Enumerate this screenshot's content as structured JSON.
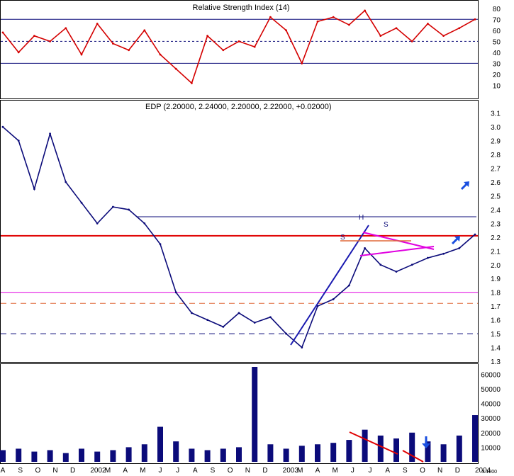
{
  "chart_data": [
    {
      "panel": "rsi",
      "type": "line",
      "title": "Relative Strength Index (14)",
      "y_ticks": [
        "80",
        "70",
        "60",
        "50",
        "40",
        "30",
        "20",
        "10"
      ],
      "ylim": [
        0,
        85
      ],
      "reference_lines": [
        {
          "value": 70,
          "style": "solid",
          "color": "#0b0b7a"
        },
        {
          "value": 50,
          "style": "dotted",
          "color": "#0b0b7a"
        },
        {
          "value": 30,
          "style": "solid",
          "color": "#0b0b7a"
        }
      ],
      "series": [
        {
          "color": "#d40000",
          "points": [
            [
              "2001-08",
              58
            ],
            [
              "2001-09",
              40
            ],
            [
              "2001-10",
              55
            ],
            [
              "2001-11",
              50
            ],
            [
              "2001-12",
              62
            ],
            [
              "2002-01",
              38
            ],
            [
              "2002-02",
              66
            ],
            [
              "2002-03",
              48
            ],
            [
              "2002-04",
              42
            ],
            [
              "2002-05",
              60
            ],
            [
              "2002-06",
              38
            ],
            [
              "2002-07",
              25
            ],
            [
              "2002-08",
              12
            ],
            [
              "2002-09",
              55
            ],
            [
              "2002-10",
              42
            ],
            [
              "2002-11",
              50
            ],
            [
              "2002-12",
              45
            ],
            [
              "2003-01",
              72
            ],
            [
              "2003-02",
              60
            ],
            [
              "2003-03",
              30
            ],
            [
              "2003-04",
              68
            ],
            [
              "2003-05",
              72
            ],
            [
              "2003-06",
              65
            ],
            [
              "2003-07",
              78
            ],
            [
              "2003-08",
              55
            ],
            [
              "2003-09",
              62
            ],
            [
              "2003-10",
              50
            ],
            [
              "2003-11",
              66
            ],
            [
              "2003-12",
              55
            ],
            [
              "2004-01",
              62
            ],
            [
              "2004-02",
              70
            ]
          ]
        }
      ],
      "grid": false
    },
    {
      "panel": "price",
      "type": "line",
      "title": "EDP (2.20000, 2.24000, 2.20000, 2.22000, +0.02000)",
      "y_ticks": [
        "3.1",
        "3.0",
        "2.9",
        "2.8",
        "2.7",
        "2.6",
        "2.5",
        "2.4",
        "2.3",
        "2.2",
        "2.1",
        "2.0",
        "1.9",
        "1.8",
        "1.7",
        "1.6",
        "1.5",
        "1.4",
        "1.3"
      ],
      "ylim": [
        1.3,
        3.15
      ],
      "series": [
        {
          "name": "EDP",
          "color": "#0b0b7a",
          "points": [
            [
              "2001-08",
              3.0
            ],
            [
              "2001-09",
              2.9
            ],
            [
              "2001-10",
              2.55
            ],
            [
              "2001-11",
              2.95
            ],
            [
              "2001-12",
              2.6
            ],
            [
              "2002-01",
              2.45
            ],
            [
              "2002-02",
              2.3
            ],
            [
              "2002-03",
              2.42
            ],
            [
              "2002-04",
              2.4
            ],
            [
              "2002-05",
              2.3
            ],
            [
              "2002-06",
              2.15
            ],
            [
              "2002-07",
              1.8
            ],
            [
              "2002-08",
              1.65
            ],
            [
              "2002-09",
              1.6
            ],
            [
              "2002-10",
              1.55
            ],
            [
              "2002-11",
              1.65
            ],
            [
              "2002-12",
              1.58
            ],
            [
              "2003-01",
              1.62
            ],
            [
              "2003-02",
              1.5
            ],
            [
              "2003-03",
              1.4
            ],
            [
              "2003-04",
              1.7
            ],
            [
              "2003-05",
              1.75
            ],
            [
              "2003-06",
              1.85
            ],
            [
              "2003-07",
              2.12
            ],
            [
              "2003-08",
              2.0
            ],
            [
              "2003-09",
              1.95
            ],
            [
              "2003-10",
              2.0
            ],
            [
              "2003-11",
              2.05
            ],
            [
              "2003-12",
              2.08
            ],
            [
              "2004-01",
              2.12
            ],
            [
              "2004-02",
              2.22
            ]
          ]
        }
      ],
      "reference_lines": [
        {
          "value": 2.21,
          "style": "solid",
          "color": "#e00000"
        },
        {
          "value": 1.8,
          "style": "solid",
          "color": "#e000e0"
        },
        {
          "value": 1.72,
          "style": "dashed",
          "color": "#e06a3a"
        },
        {
          "value": 1.5,
          "style": "dashed",
          "color": "#0b0b7a"
        }
      ],
      "annotations": [
        "S",
        "H",
        "S"
      ],
      "grid": false
    },
    {
      "panel": "volume",
      "type": "bar",
      "y_ticks": [
        "60000",
        "50000",
        "40000",
        "30000",
        "20000",
        "10000"
      ],
      "unit_label": "x 1000",
      "ylim": [
        0,
        65000
      ],
      "series": [
        {
          "color": "#0b0b7a",
          "points": [
            [
              "2001-08",
              8000
            ],
            [
              "2001-09",
              9000
            ],
            [
              "2001-10",
              7000
            ],
            [
              "2001-11",
              8000
            ],
            [
              "2001-12",
              6000
            ],
            [
              "2002-01",
              9000
            ],
            [
              "2002-02",
              7000
            ],
            [
              "2002-03",
              8000
            ],
            [
              "2002-04",
              10000
            ],
            [
              "2002-05",
              12000
            ],
            [
              "2002-06",
              24000
            ],
            [
              "2002-07",
              14000
            ],
            [
              "2002-08",
              9000
            ],
            [
              "2002-09",
              8000
            ],
            [
              "2002-10",
              9000
            ],
            [
              "2002-11",
              10000
            ],
            [
              "2002-12",
              65000
            ],
            [
              "2003-01",
              12000
            ],
            [
              "2003-02",
              9000
            ],
            [
              "2003-03",
              11000
            ],
            [
              "2003-04",
              12000
            ],
            [
              "2003-05",
              13000
            ],
            [
              "2003-06",
              15000
            ],
            [
              "2003-07",
              22000
            ],
            [
              "2003-08",
              18000
            ],
            [
              "2003-09",
              16000
            ],
            [
              "2003-10",
              20000
            ],
            [
              "2003-11",
              14000
            ],
            [
              "2003-12",
              12000
            ],
            [
              "2004-01",
              18000
            ],
            [
              "2004-02",
              32000
            ]
          ]
        }
      ],
      "grid": false
    }
  ],
  "x_axis": {
    "labels": [
      "A",
      "S",
      "O",
      "N",
      "D",
      "2002",
      "M",
      "A",
      "M",
      "J",
      "J",
      "A",
      "S",
      "O",
      "N",
      "D",
      "2003",
      "M",
      "A",
      "M",
      "J",
      "J",
      "A",
      "S",
      "O",
      "N",
      "D",
      "2004"
    ]
  },
  "colors": {
    "axis": "#000000",
    "price_line": "#0b0b7a",
    "rsi_line": "#d40000",
    "resistance": "#e00000",
    "triangle": "#e000e0",
    "trend": "#1a1ab0",
    "arrow": "#1a4fe0"
  }
}
